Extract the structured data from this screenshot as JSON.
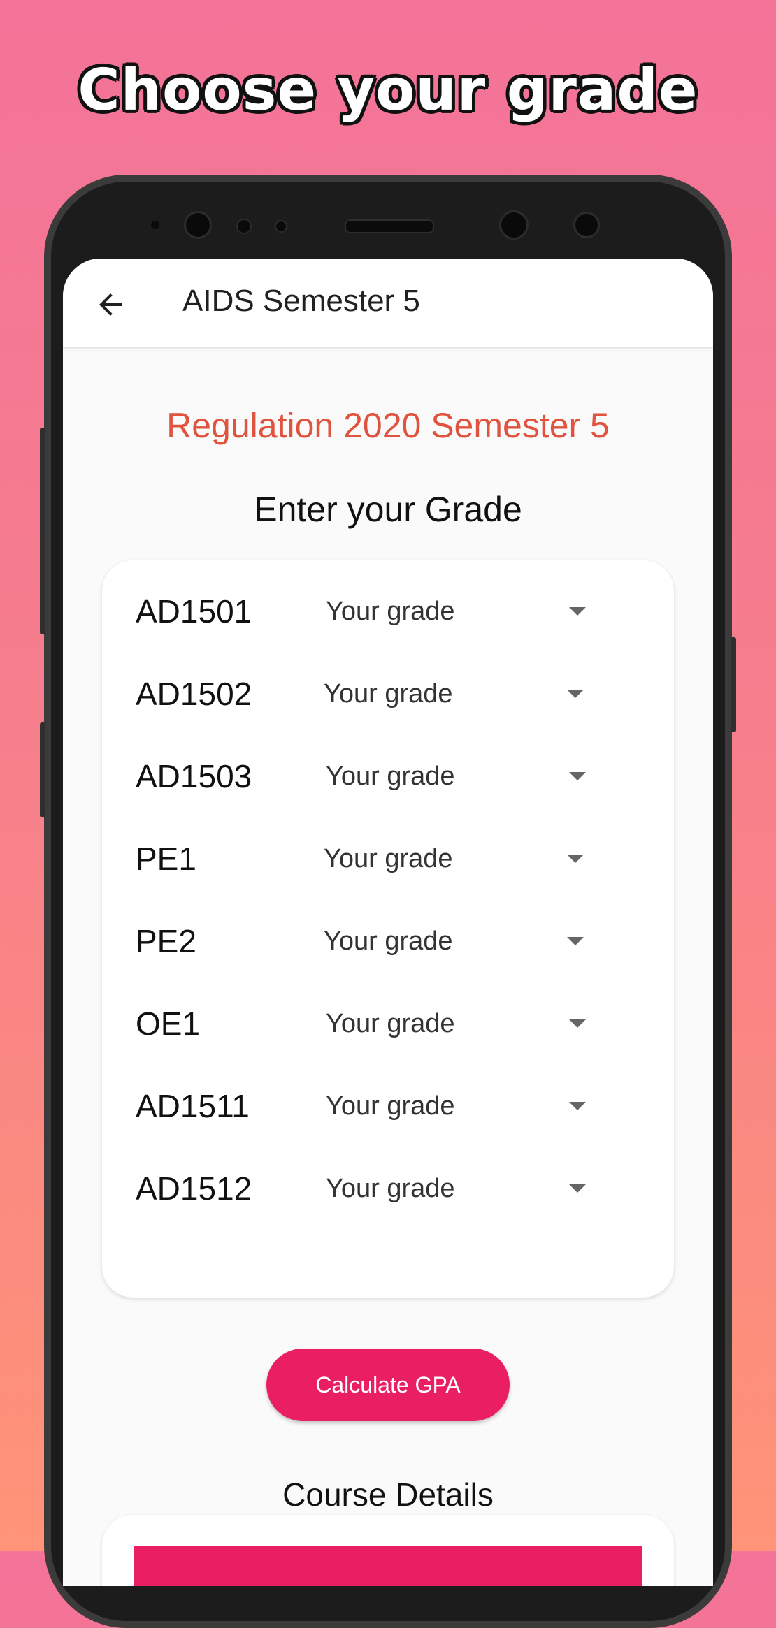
{
  "headline": "Choose your grade",
  "appbar": {
    "title": "AIDS Semester 5",
    "back_icon": "arrow-back-icon"
  },
  "regulation_heading": "Regulation 2020 Semester 5",
  "enter_grade_label": "Enter your Grade",
  "courses": [
    {
      "code": "AD1501",
      "grade": "Your grade"
    },
    {
      "code": "AD1502",
      "grade": "Your grade"
    },
    {
      "code": "AD1503",
      "grade": "Your grade"
    },
    {
      "code": "PE1",
      "grade": "Your grade"
    },
    {
      "code": "PE2",
      "grade": "Your grade"
    },
    {
      "code": "OE1",
      "grade": "Your grade"
    },
    {
      "code": "AD1511",
      "grade": "Your grade"
    },
    {
      "code": "AD1512",
      "grade": "Your grade"
    }
  ],
  "calculate_button": "Calculate GPA",
  "course_details_label": "Course Details",
  "colors": {
    "accent": "#e91e63",
    "heading": "#e0533e"
  }
}
